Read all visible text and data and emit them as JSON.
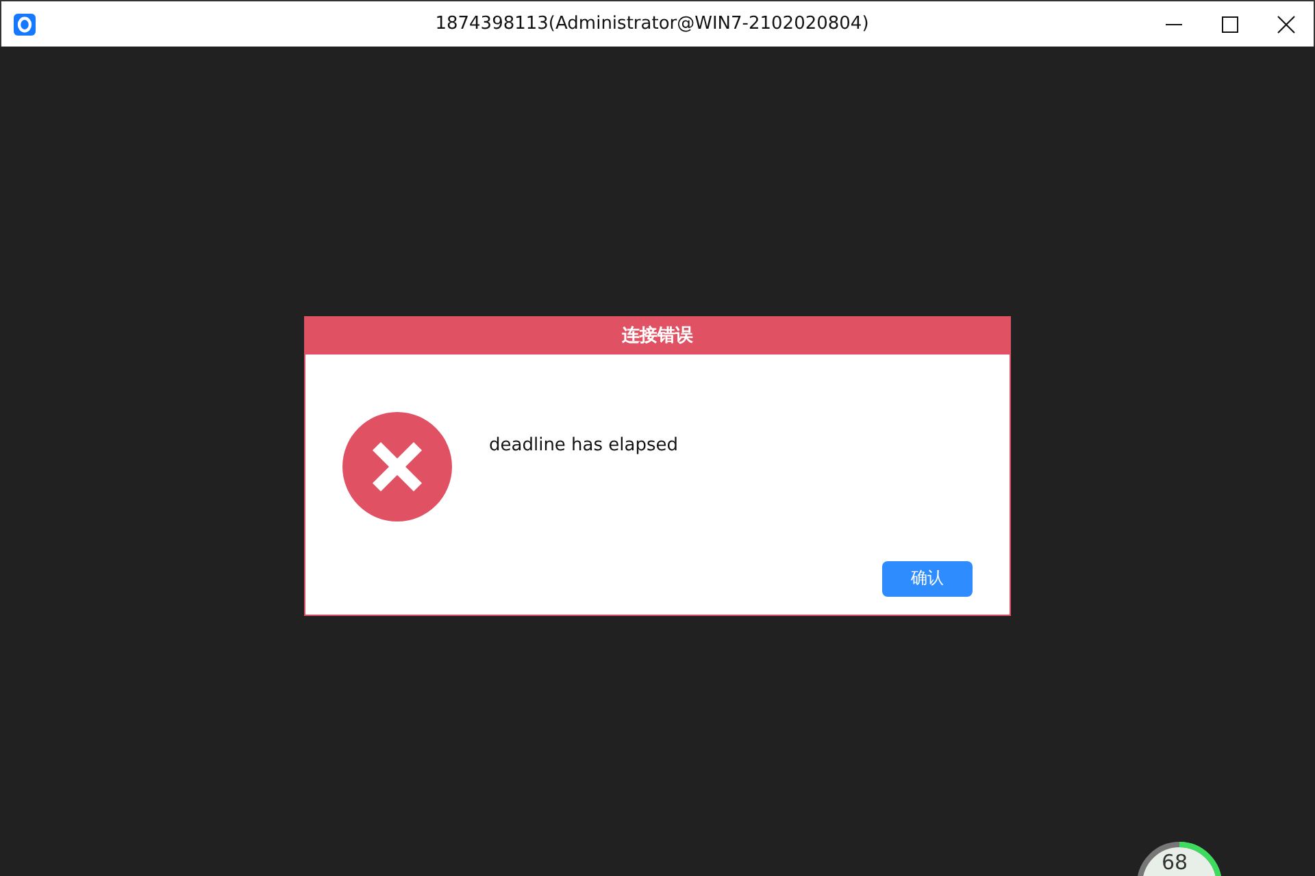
{
  "window": {
    "title": "1874398113(Administrator@WIN7-2102020804)"
  },
  "dialog": {
    "title": "连接错误",
    "message": "deadline has elapsed",
    "buttons": [
      "确认"
    ]
  },
  "gauge": {
    "reading": "68"
  }
}
